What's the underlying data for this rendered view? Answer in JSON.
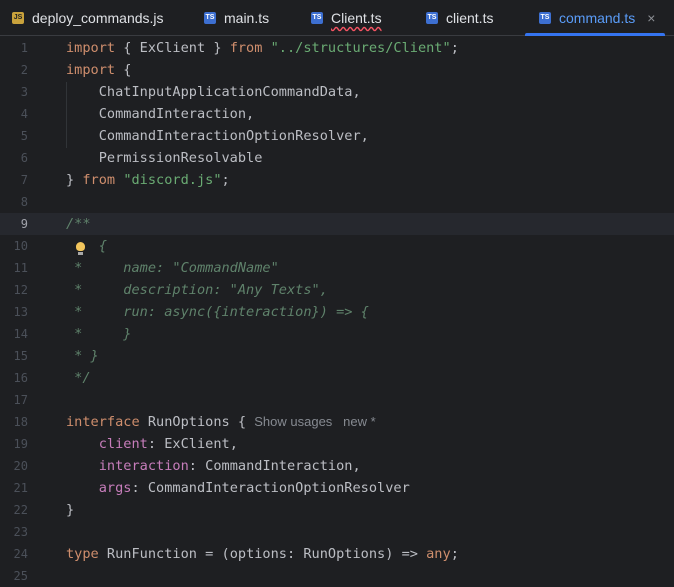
{
  "tabs": [
    {
      "icon": "JS",
      "name": "deploy_commands.js",
      "active": false
    },
    {
      "icon": "TS",
      "name": "main.ts",
      "active": false
    },
    {
      "icon": "TS",
      "name": "Client.ts",
      "active": false,
      "error": true
    },
    {
      "icon": "TS",
      "name": "client.ts",
      "active": false
    },
    {
      "icon": "TS",
      "name": "command.ts",
      "active": true
    }
  ],
  "close_glyph": "×",
  "current_line": 9,
  "line_numbers": [
    "1",
    "2",
    "3",
    "4",
    "5",
    "6",
    "7",
    "8",
    "9",
    "10",
    "11",
    "12",
    "13",
    "14",
    "15",
    "16",
    "17",
    "18",
    "19",
    "20",
    "21",
    "22",
    "23",
    "24",
    "25"
  ],
  "code": {
    "l1": {
      "kw1": "import",
      "t1": " { ExClient } ",
      "kw2": "from",
      "sp": " ",
      "str": "\"../structures/Client\"",
      "t2": ";"
    },
    "l2": {
      "kw1": "import",
      "t1": " {"
    },
    "l3": "    ChatInputApplicationCommandData,",
    "l4": "    CommandInteraction,",
    "l5": "    CommandInteractionOptionResolver,",
    "l6": "    PermissionResolvable",
    "l7": {
      "t1": "} ",
      "kw": "from",
      "sp": " ",
      "str": "\"discord.js\"",
      "t2": ";"
    },
    "l9": "/**",
    "l10": "    {",
    "l11": " *     name: \"CommandName\"",
    "l12": " *     description: \"Any Texts\",",
    "l13": " *     run: async({interaction}) => {",
    "l14": " *     }",
    "l15": " * }",
    "l16": " */",
    "l18": {
      "kw": "interface",
      "t1": " RunOptions { ",
      "hint1": "Show usages",
      "hint2": "new *"
    },
    "l19": {
      "indent": "    ",
      "prop": "client",
      "t1": ": ExClient,"
    },
    "l20": {
      "indent": "    ",
      "prop": "interaction",
      "t1": ": CommandInteraction,"
    },
    "l21": {
      "indent": "    ",
      "prop": "args",
      "t1": ": CommandInteractionOptionResolver"
    },
    "l22": "}",
    "l24": {
      "kw": "type",
      "t1": " RunFunction = (options: RunOptions) => ",
      "kw2": "any",
      "t2": ";"
    }
  }
}
